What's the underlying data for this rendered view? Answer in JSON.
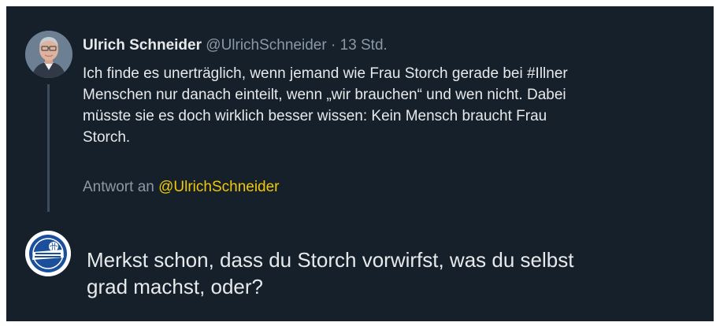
{
  "parent_tweet": {
    "author_name": "Ulrich Schneider",
    "author_handle": "@UlrichSchneider",
    "separator": "·",
    "timestamp": "13 Std.",
    "text": "Ich finde es unerträglich, wenn jemand wie Frau Storch gerade bei #Illner\nMenschen nur danach einteilt, wenn „wir brauchen“ und wen nicht. Dabei\nmüsste sie es doch wirklich besser wissen: Kein Mensch braucht Frau\nStorch.",
    "avatar_icon": "user-portrait-avatar"
  },
  "reply_context": {
    "prefix": "Antwort an",
    "handle": "@UlrichSchneider"
  },
  "reply": {
    "text": "Merkst schon, dass du Storch vorwirfst, was du selbst\ngrad machst, oder?",
    "avatar_icon": "team-logo-avatar"
  },
  "colors": {
    "background": "#15202b",
    "primary_text": "#e7e9ea",
    "secondary_text": "#8b98a5",
    "mention": "#f0c808",
    "thread_line": "#3d4c5c"
  }
}
